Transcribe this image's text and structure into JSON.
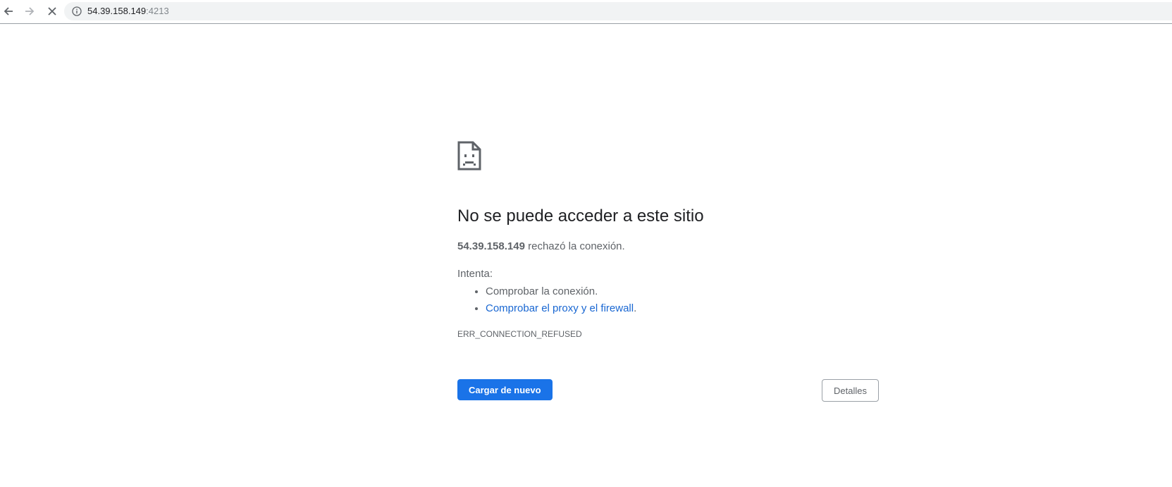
{
  "browser": {
    "url_host": "54.39.158.149",
    "url_port": ":4213",
    "icons": {
      "back": "arrow-left-icon",
      "forward": "arrow-right-icon",
      "stop": "close-icon",
      "site_info": "info-icon"
    }
  },
  "error_page": {
    "icon": "sad-page-icon",
    "title": "No se puede acceder a este sitio",
    "host": "54.39.158.149",
    "summary_suffix": " rechazó la conexión.",
    "suggestions_label": "Intenta:",
    "suggestions": [
      "Comprobar la conexión.",
      "Comprobar el proxy y el firewall"
    ],
    "suggestion_suffix": ".",
    "error_code": "ERR_CONNECTION_REFUSED",
    "reload_label": "Cargar de nuevo",
    "details_label": "Detalles"
  },
  "colors": {
    "primary_button": "#1a73e8",
    "link": "#1967d2",
    "text": "#202124",
    "secondary_text": "#5f6368"
  }
}
